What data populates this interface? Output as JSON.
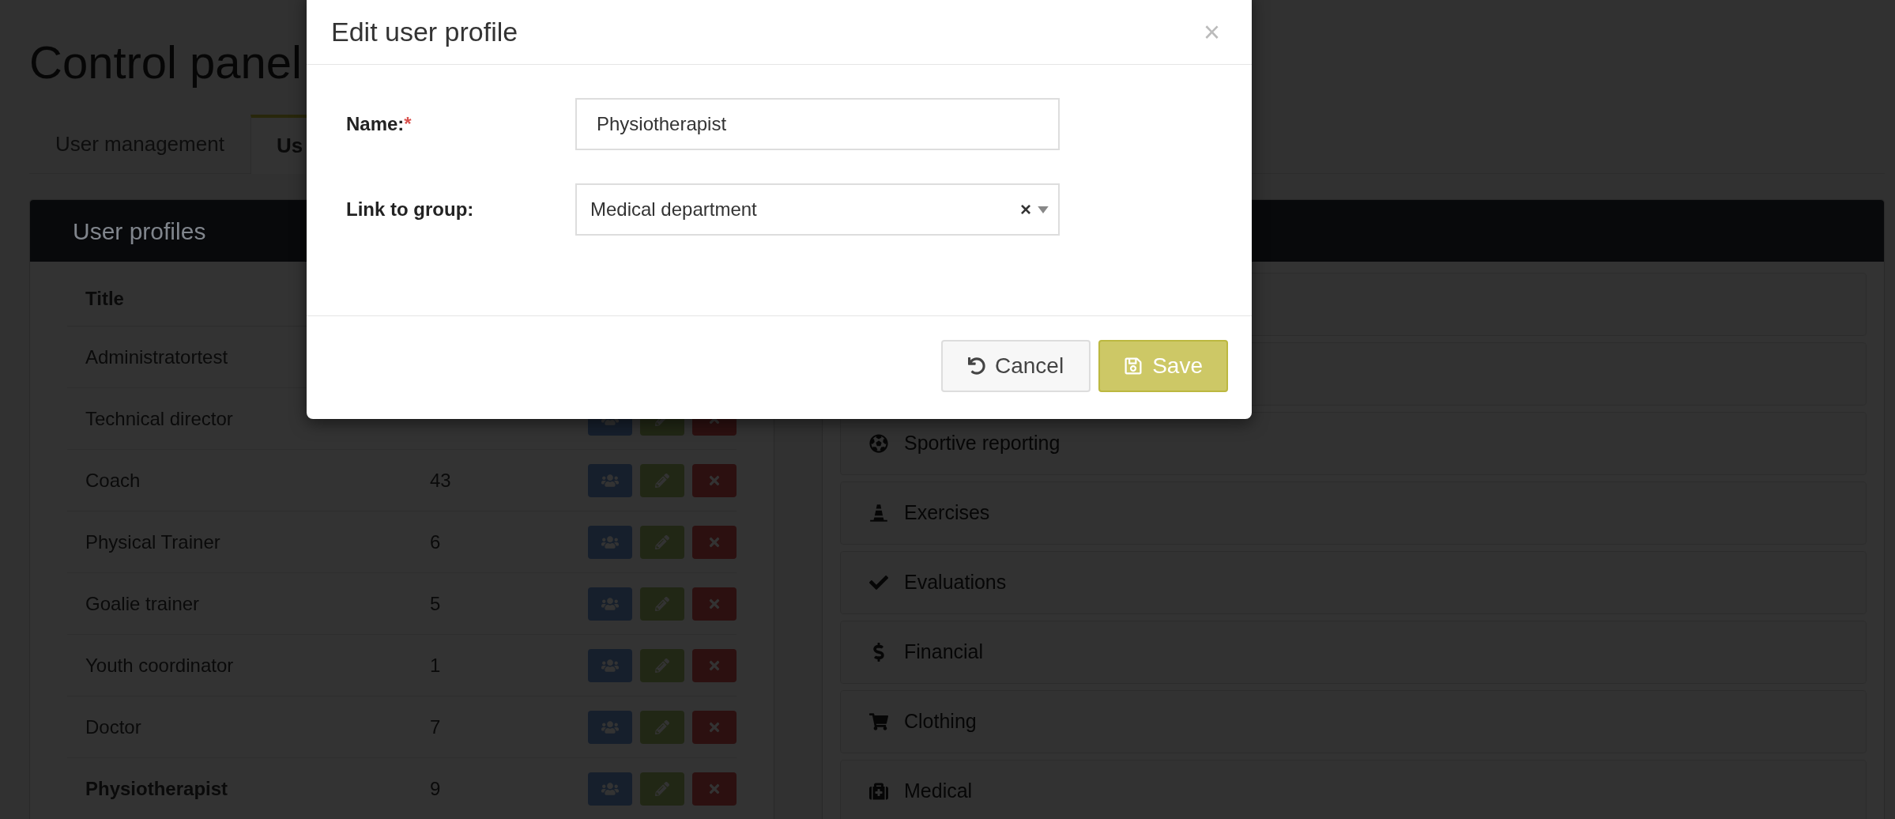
{
  "page": {
    "title": "Control panel"
  },
  "tabs": [
    {
      "label": "User management",
      "selected": false
    },
    {
      "label": "Us",
      "selected": true
    }
  ],
  "profiles_panel": {
    "title": "User profiles",
    "columns": [
      "Title"
    ],
    "rows": [
      {
        "title": "Administratortest",
        "selected": false
      },
      {
        "title": "Technical director",
        "selected": false,
        "actions": true
      },
      {
        "title": "Coach",
        "count": "43",
        "selected": false,
        "actions": true
      },
      {
        "title": "Physical Trainer",
        "count": "6",
        "selected": false,
        "actions": true
      },
      {
        "title": "Goalie trainer",
        "count": "5",
        "selected": false,
        "actions": true
      },
      {
        "title": "Youth coordinator",
        "count": "1",
        "selected": false,
        "actions": true
      },
      {
        "title": "Doctor",
        "count": "7",
        "selected": false,
        "actions": true
      },
      {
        "title": "Physiotherapist",
        "count": "9",
        "selected": true,
        "actions": true
      }
    ]
  },
  "modules_panel": {
    "items": [
      {
        "kind": "soccer",
        "label": "Sportive reporting"
      },
      {
        "kind": "cone",
        "label": "Exercises"
      },
      {
        "kind": "check",
        "label": "Evaluations"
      },
      {
        "kind": "dollar",
        "label": "Financial"
      },
      {
        "kind": "cart",
        "label": "Clothing"
      },
      {
        "kind": "medkit",
        "label": "Medical"
      }
    ]
  },
  "dialog": {
    "title": "Edit user profile",
    "close": "×",
    "fields": [
      {
        "kind": "text",
        "label": "Name:",
        "required_mark": "*",
        "value": "Physiotherapist"
      },
      {
        "kind": "select",
        "label": "Link to group:",
        "value": "Medical department",
        "clear": "×"
      }
    ],
    "buttons": [
      {
        "kind": "cancel",
        "label": "Cancel"
      },
      {
        "kind": "save",
        "label": "Save"
      }
    ]
  }
}
